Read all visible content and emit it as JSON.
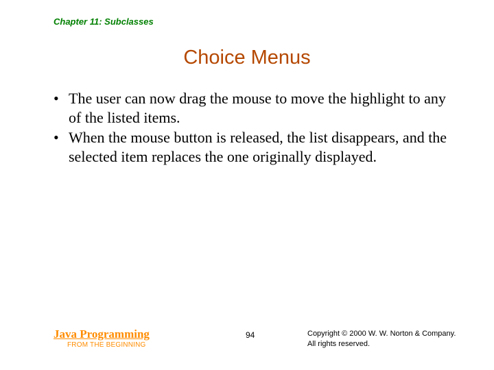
{
  "header": {
    "chapter_label": "Chapter 11: Subclasses"
  },
  "title": "Choice Menus",
  "bullets": [
    "The user can now drag the mouse to move the highlight to any of the listed items.",
    "When the mouse button is released, the list disappears, and the selected item replaces the one originally displayed."
  ],
  "footer": {
    "book_title": "Java Programming",
    "book_subtitle": "FROM THE BEGINNING",
    "page_number": "94",
    "copyright_line1": "Copyright © 2000 W. W. Norton & Company.",
    "copyright_line2": "All rights reserved."
  }
}
